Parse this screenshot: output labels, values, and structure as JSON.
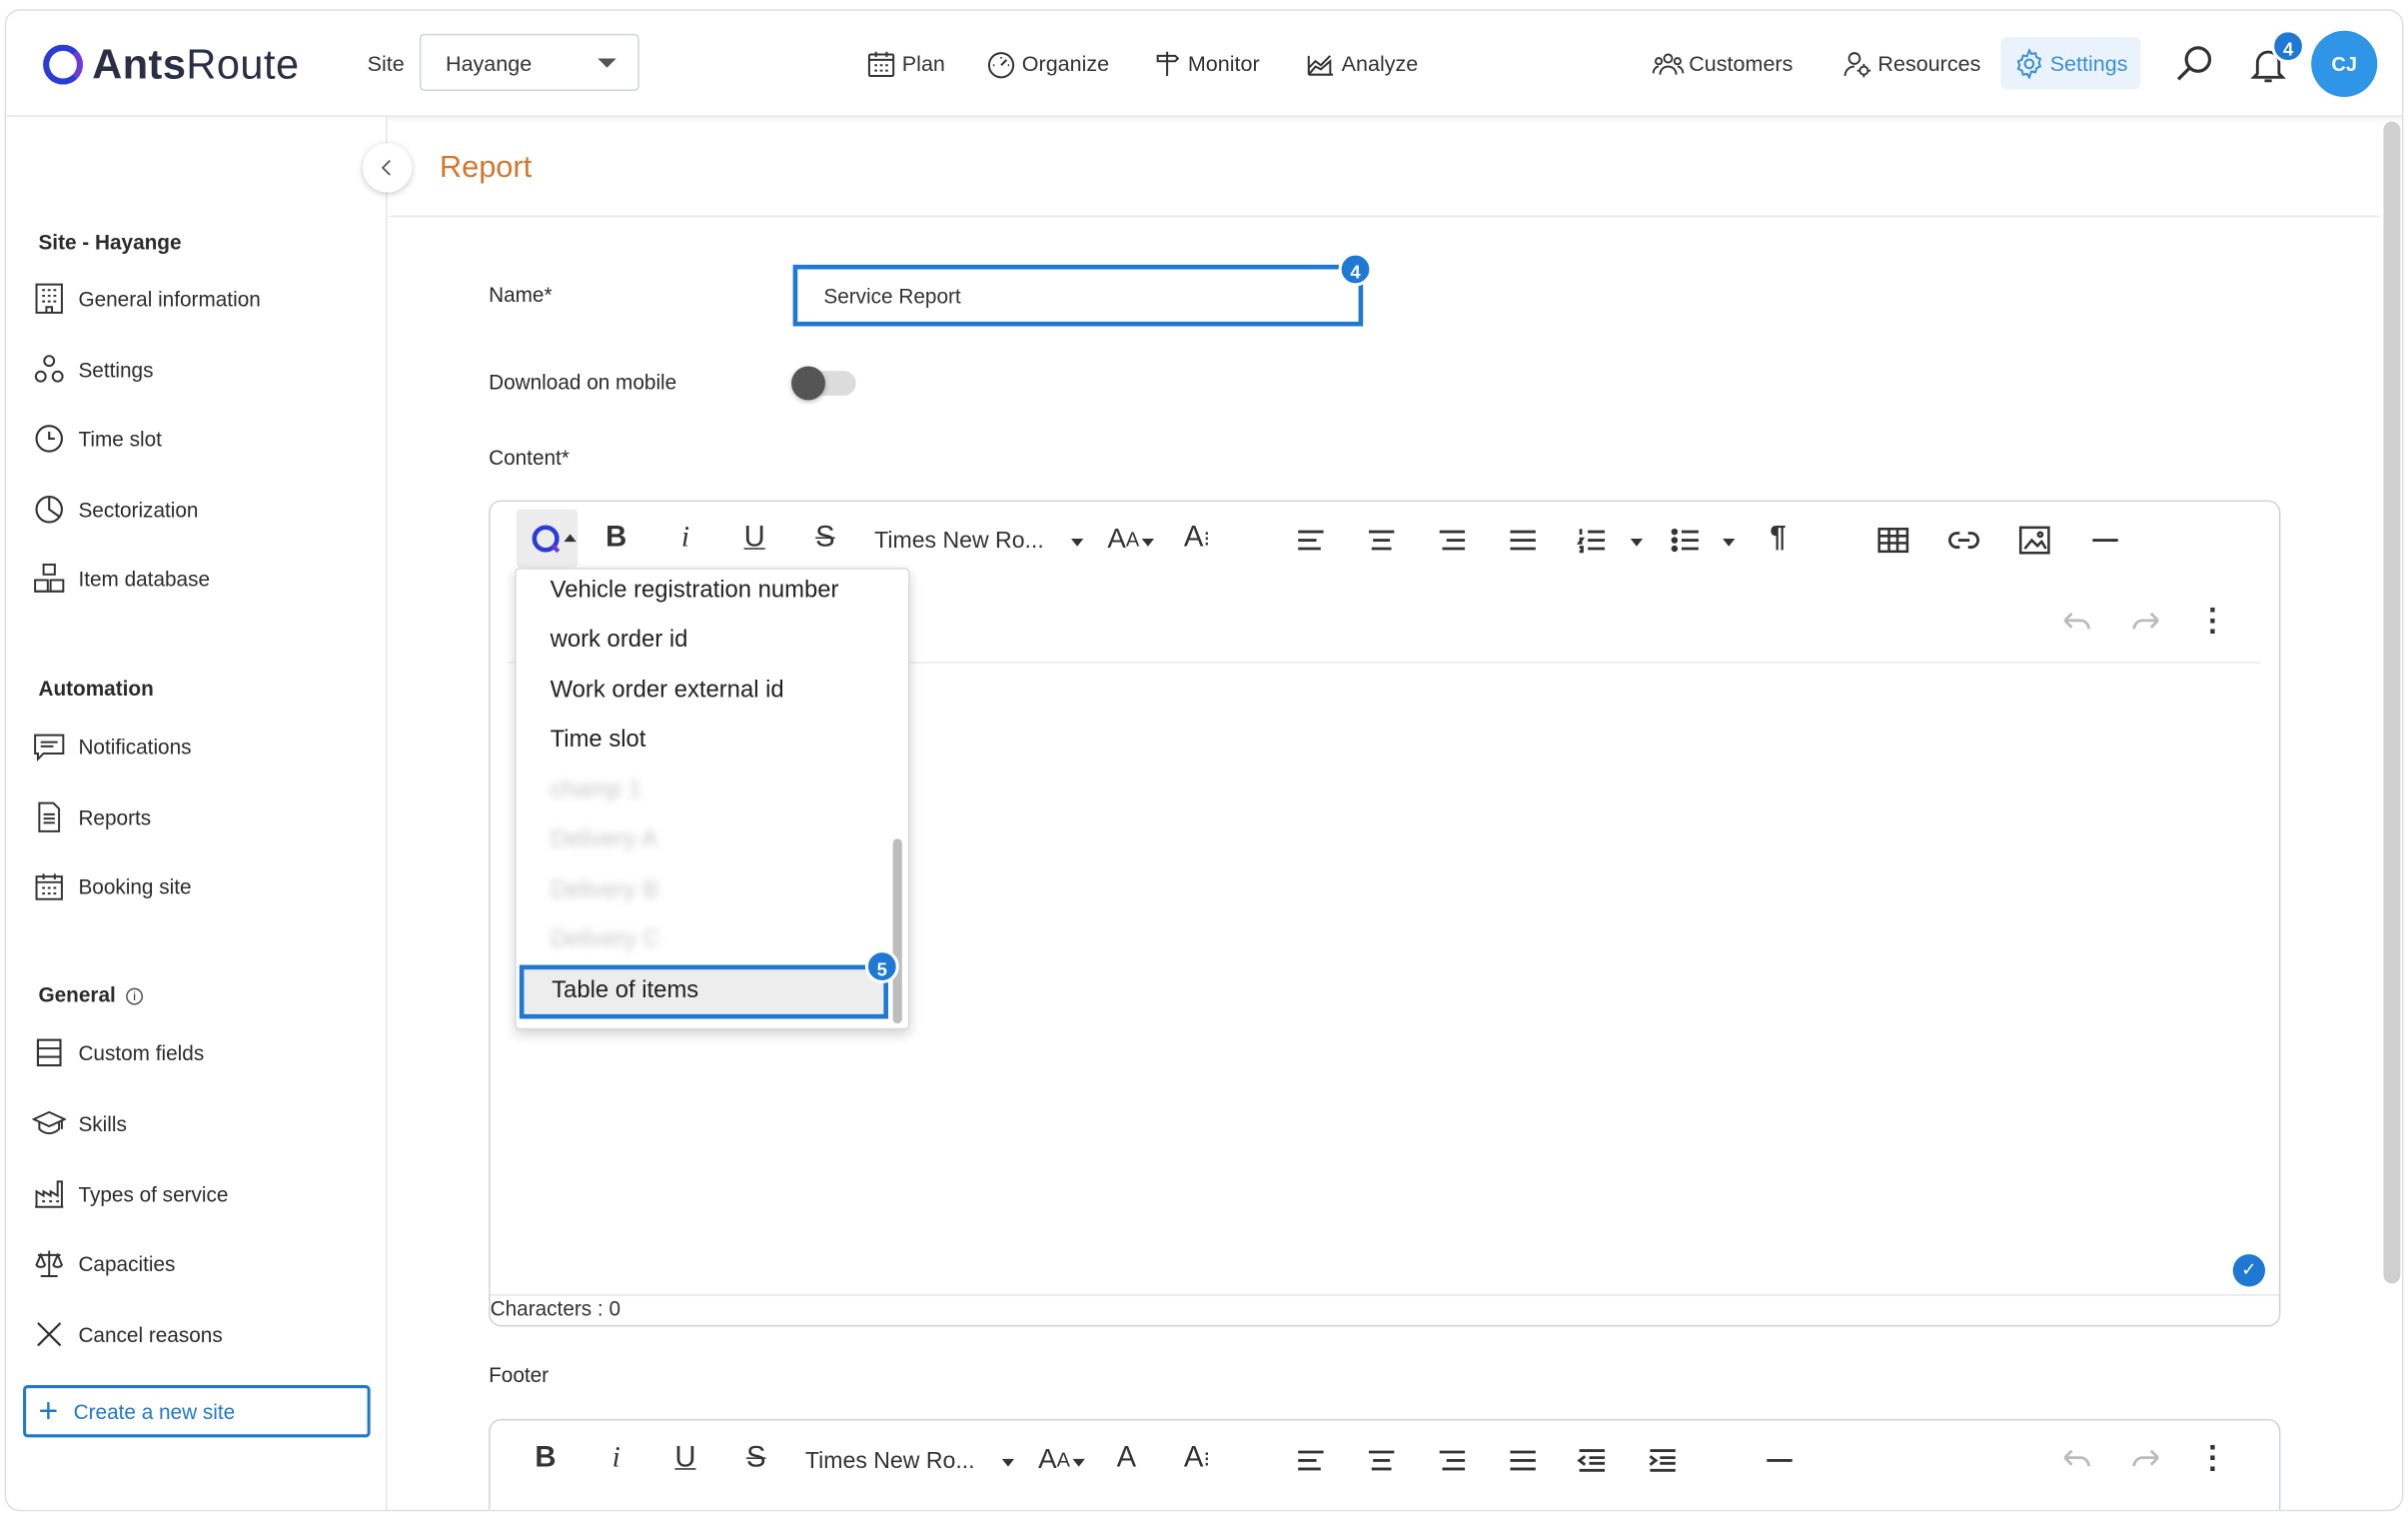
{
  "app": {
    "logo_prefix": "Ants",
    "logo_suffix": "Route",
    "site_label": "Site",
    "site_value": "Hayange"
  },
  "nav": {
    "plan": "Plan",
    "organize": "Organize",
    "monitor": "Monitor",
    "analyze": "Analyze",
    "customers": "Customers",
    "resources": "Resources",
    "settings": "Settings",
    "notifications_count": "4",
    "avatar_initials": "CJ"
  },
  "sidebar": {
    "section_site": "Site - Hayange",
    "site_items": [
      "General information",
      "Settings",
      "Time slot",
      "Sectorization",
      "Item database"
    ],
    "section_automation": "Automation",
    "automation_items": [
      "Notifications",
      "Reports",
      "Booking site"
    ],
    "section_general": "General",
    "general_items": [
      "Custom fields",
      "Skills",
      "Types of service",
      "Capacities",
      "Cancel reasons"
    ],
    "create_button": "Create a new site"
  },
  "main": {
    "title": "Report",
    "name_label": "Name*",
    "name_value": "Service Report",
    "step_name_badge": "4",
    "download_label": "Download on mobile",
    "download_on": false,
    "content_label": "Content*",
    "footer_label": "Footer",
    "characters_label": "Characters : 0"
  },
  "editor": {
    "font_name": "Times New Ro...",
    "footer_font_name": "Times New Ro..."
  },
  "dropdown": {
    "items": [
      "Vehicle registration number",
      "work order id",
      "Work order external id",
      "Time slot"
    ],
    "blurred_items": [
      "champ 1",
      "Delivery A",
      "Delivery B",
      "Delivery C"
    ],
    "selected_item": "Table of items",
    "step_badge": "5"
  },
  "colors": {
    "accent": "#1e78d4",
    "title": "#d1782d",
    "settings_active": "#3a8fd6"
  }
}
